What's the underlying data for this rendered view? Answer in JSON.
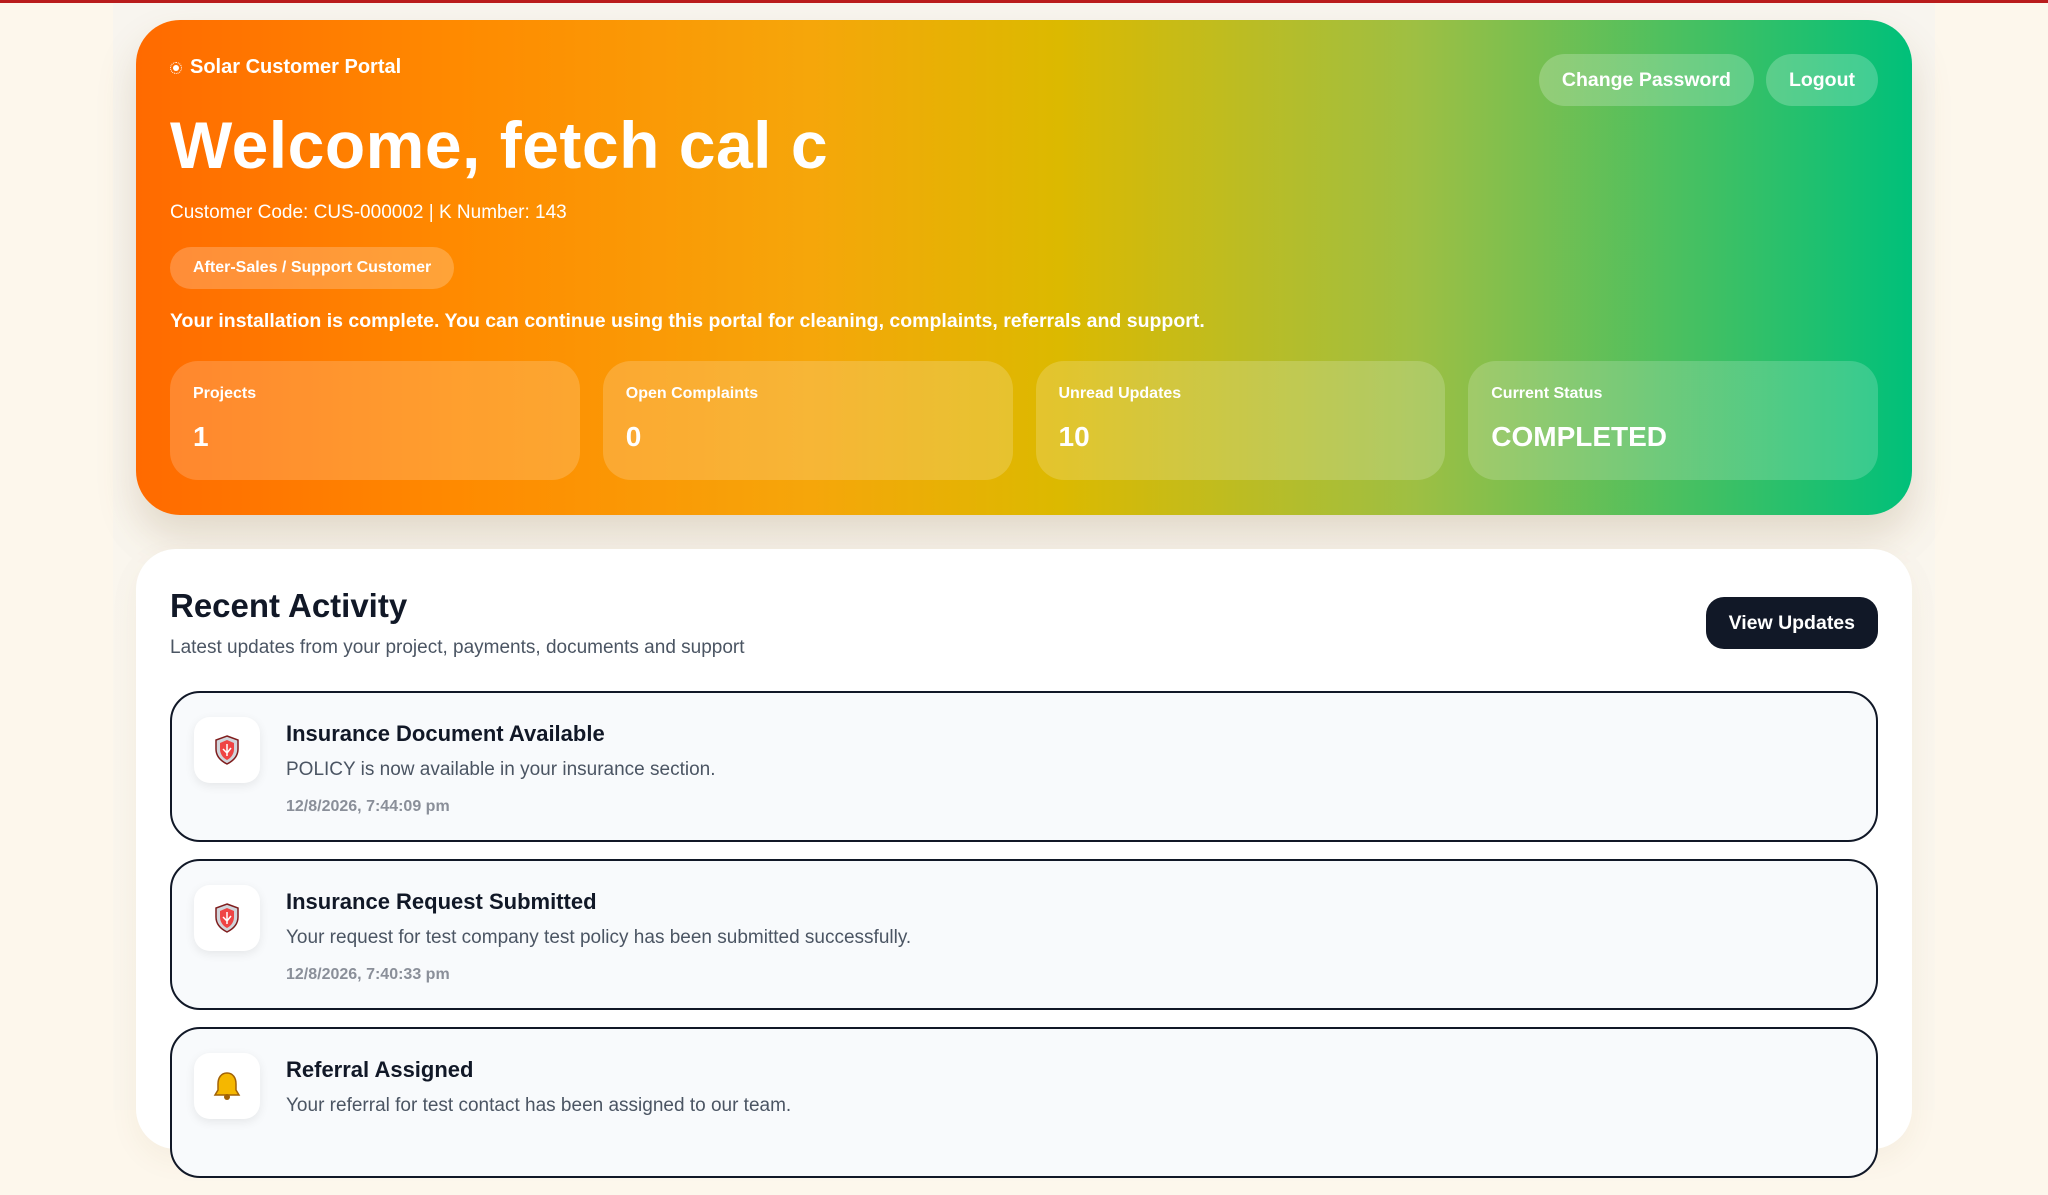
{
  "header": {
    "brand": "Solar Customer Portal",
    "welcome": "Welcome, fetch cal c",
    "customer_info": "Customer Code: CUS-000002 | K Number: 143",
    "customer_type": "After-Sales / Support Customer",
    "install_message": "Your installation is complete. You can continue using this portal for cleaning, complaints, referrals and support.",
    "change_password": "Change Password",
    "logout": "Logout"
  },
  "stats": [
    {
      "label": "Projects",
      "value": "1"
    },
    {
      "label": "Open Complaints",
      "value": "0"
    },
    {
      "label": "Unread Updates",
      "value": "10"
    },
    {
      "label": "Current Status",
      "value": "COMPLETED"
    }
  ],
  "activity": {
    "title": "Recent Activity",
    "subtitle": "Latest updates from your project, payments, documents and support",
    "view_updates": "View Updates",
    "items": [
      {
        "icon": "shield-icon",
        "title": "Insurance Document Available",
        "description": "POLICY is now available in your insurance section.",
        "time": "12/8/2026, 7:44:09 pm"
      },
      {
        "icon": "shield-icon",
        "title": "Insurance Request Submitted",
        "description": "Your request for test company test policy has been submitted successfully.",
        "time": "12/8/2026, 7:40:33 pm"
      },
      {
        "icon": "bell-icon",
        "title": "Referral Assigned",
        "description": "Your referral for test contact has been assigned to our team.",
        "time": ""
      }
    ]
  },
  "colors": {
    "hero_start": "#ff6a00",
    "hero_mid": "#dcb900",
    "hero_end": "#00c07a",
    "dark_button": "#111827",
    "top_line": "#b91c1c"
  }
}
